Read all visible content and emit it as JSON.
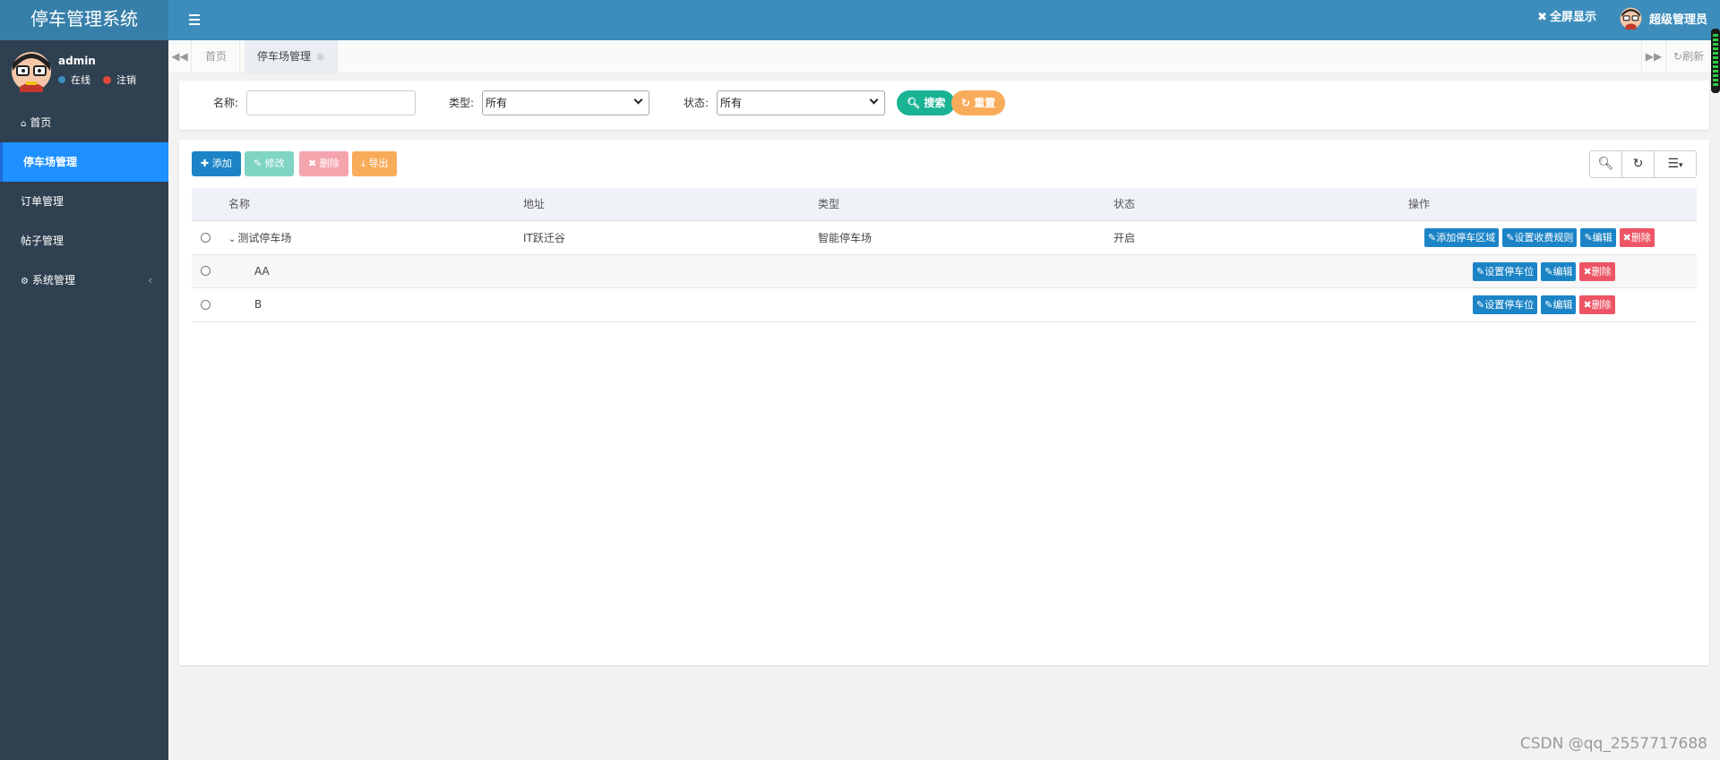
{
  "app": {
    "title": "停车管理系统"
  },
  "header": {
    "fullscreen_label": "全屏显示",
    "user_label": "超级管理员"
  },
  "user": {
    "name": "admin",
    "status": "在线",
    "logout": "注销"
  },
  "sidebar": {
    "items": [
      {
        "label": "首页",
        "icon": "home-icon"
      },
      {
        "label": "停车场管理",
        "active": true
      },
      {
        "label": "订单管理"
      },
      {
        "label": "帖子管理"
      },
      {
        "label": "系统管理",
        "icon": "gear-icon",
        "has_children": true
      }
    ]
  },
  "tabs": {
    "items": [
      {
        "label": "首页"
      },
      {
        "label": "停车场管理",
        "active": true
      }
    ],
    "refresh_label": "刷新"
  },
  "search": {
    "name_label": "名称:",
    "name_value": "",
    "type_label": "类型:",
    "type_value": "所有",
    "status_label": "状态:",
    "status_value": "所有",
    "search_btn": "搜索",
    "reset_btn": "重置"
  },
  "toolbar": {
    "add": "添加",
    "edit": "修改",
    "delete": "删除",
    "export": "导出"
  },
  "table": {
    "columns": [
      "名称",
      "地址",
      "类型",
      "状态",
      "操作"
    ],
    "rows": [
      {
        "name": "测试停车场",
        "address": "IT跃迁谷",
        "type": "智能停车场",
        "status": "开启",
        "expanded": true,
        "ops": [
          "添加停车区域",
          "设置收费规则",
          "编辑",
          "删除"
        ]
      },
      {
        "name": "AA",
        "address": "",
        "type": "",
        "status": "",
        "ops": [
          "设置停车位",
          "编辑",
          "删除"
        ]
      },
      {
        "name": "B",
        "address": "",
        "type": "",
        "status": "",
        "ops": [
          "设置停车位",
          "编辑",
          "删除"
        ]
      }
    ]
  },
  "colors": {
    "header": "#3c8dbc",
    "sidebar": "#2f4050",
    "active": "#1e90ff",
    "primary": "#1c84c6",
    "success": "#1ab394",
    "warning": "#f8ac59",
    "danger": "#ed5565"
  },
  "watermark": "CSDN @qq_2557717688"
}
